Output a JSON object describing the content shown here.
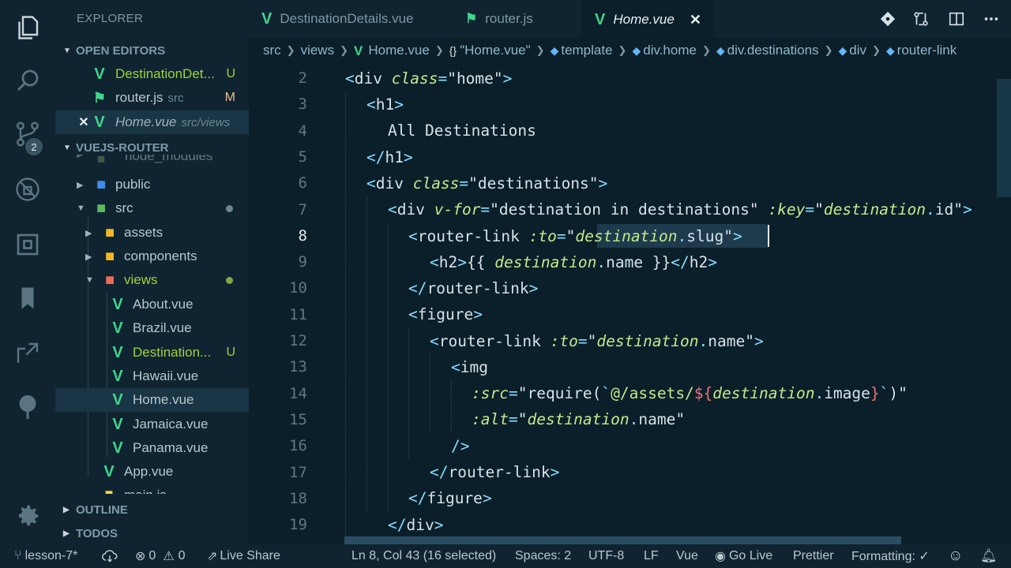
{
  "activity": {
    "scm_badge": "2"
  },
  "sidebar": {
    "title": "EXPLORER",
    "open_editors": {
      "header": "OPEN EDITORS",
      "items": [
        {
          "label": "DestinationDet...",
          "desc": "",
          "status": "U"
        },
        {
          "label": "router.js",
          "desc": "src",
          "status": "M"
        },
        {
          "label": "Home.vue",
          "desc": "src/views",
          "status": ""
        }
      ]
    },
    "project": {
      "header": "VUEJS-ROUTER",
      "items": [
        {
          "label": "node_modules"
        },
        {
          "label": "public"
        },
        {
          "label": "src"
        },
        {
          "label": "assets"
        },
        {
          "label": "components"
        },
        {
          "label": "views"
        },
        {
          "label": "About.vue"
        },
        {
          "label": "Brazil.vue"
        },
        {
          "label": "Destination...",
          "status": "U"
        },
        {
          "label": "Hawaii.vue"
        },
        {
          "label": "Home.vue"
        },
        {
          "label": "Jamaica.vue"
        },
        {
          "label": "Panama.vue"
        },
        {
          "label": "App.vue"
        },
        {
          "label": "main.js"
        }
      ]
    },
    "outline": "OUTLINE",
    "todos": "TODOS"
  },
  "tabs": [
    {
      "label": "DestinationDetails.vue"
    },
    {
      "label": "router.js"
    },
    {
      "label": "Home.vue",
      "active": true
    }
  ],
  "breadcrumb": [
    "src",
    "views",
    "Home.vue",
    "\"Home.vue\"",
    "template",
    "div.home",
    "div.destinations",
    "div",
    "router-link"
  ],
  "editor": {
    "line_numbers": [
      "2",
      "3",
      "4",
      "5",
      "6",
      "7",
      "8",
      "9",
      "10",
      "11",
      "12",
      "13",
      "14",
      "15",
      "16",
      "17",
      "18",
      "19"
    ]
  },
  "status": {
    "branch": "lesson-7*",
    "errors": "0",
    "warnings": "0",
    "live_share": "Live Share",
    "position": "Ln 8, Col 43 (16 selected)",
    "spaces": "Spaces: 2",
    "encoding": "UTF-8",
    "eol": "LF",
    "language": "Vue",
    "go_live": "Go Live",
    "prettier": "Prettier",
    "formatting": "Formatting: ✓"
  },
  "colors": {
    "background": "#0b1f2a",
    "sidebar": "#0f2430",
    "vue_green": "#41d48e",
    "untracked": "#9bd33a",
    "modified": "#e2c08d"
  }
}
